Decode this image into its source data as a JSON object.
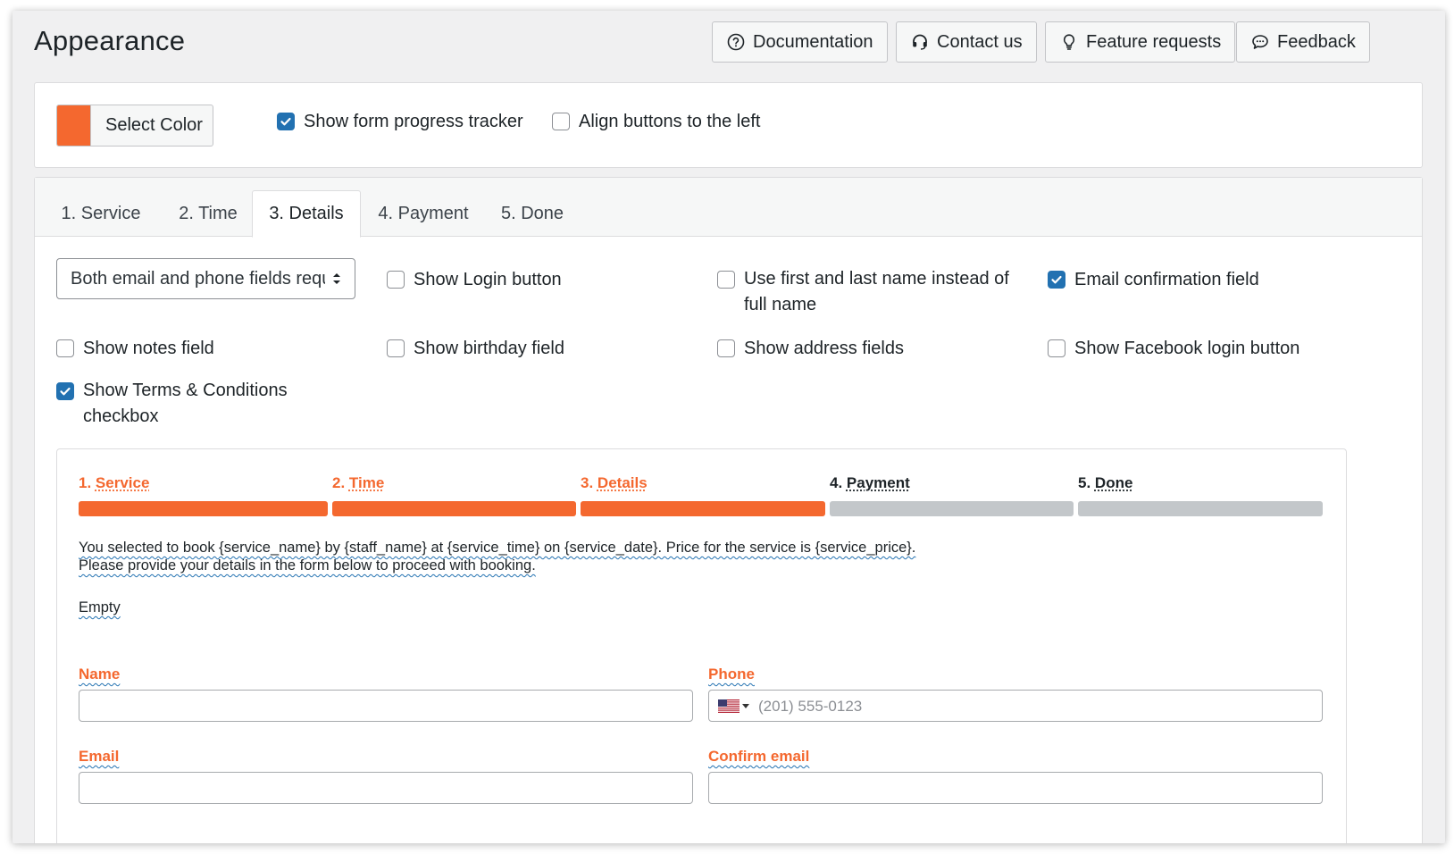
{
  "page": {
    "title": "Appearance"
  },
  "header_buttons": {
    "documentation": "Documentation",
    "contact": "Contact us",
    "features": "Feature requests",
    "feedback": "Feedback"
  },
  "general": {
    "select_color_label": "Select Color",
    "selected_color": "#f4682f",
    "show_progress_tracker": {
      "label": "Show form progress tracker",
      "checked": true
    },
    "align_buttons_left": {
      "label": "Align buttons to the left",
      "checked": false
    }
  },
  "tabs": [
    {
      "label": "1. Service",
      "active": false
    },
    {
      "label": "2. Time",
      "active": false
    },
    {
      "label": "3. Details",
      "active": true
    },
    {
      "label": "4. Payment",
      "active": false
    },
    {
      "label": "5. Done",
      "active": false
    }
  ],
  "details_options": {
    "required_fields_select": "Both email and phone fields required",
    "show_login_button": {
      "label": "Show Login button",
      "checked": false
    },
    "first_last_name": {
      "label": "Use first and last name instead of full name",
      "checked": false
    },
    "email_confirmation": {
      "label": "Email confirmation field",
      "checked": true
    },
    "show_notes": {
      "label": "Show notes field",
      "checked": false
    },
    "show_birthday": {
      "label": "Show birthday field",
      "checked": false
    },
    "show_address": {
      "label": "Show address fields",
      "checked": false
    },
    "show_facebook_login": {
      "label": "Show Facebook login button",
      "checked": false
    },
    "show_terms": {
      "label": "Show Terms & Conditions checkbox",
      "checked": true
    }
  },
  "preview": {
    "steps": [
      {
        "num": "1.",
        "name": "Service",
        "done": true
      },
      {
        "num": "2.",
        "name": "Time",
        "done": true
      },
      {
        "num": "3.",
        "name": "Details",
        "done": true
      },
      {
        "num": "4.",
        "name": "Payment",
        "done": false
      },
      {
        "num": "5.",
        "name": "Done",
        "done": false
      }
    ],
    "info_line1": "You selected to book {service_name} by {staff_name} at {service_time} on {service_date}. Price for the service is {service_price}.",
    "info_line2": "Please provide your details in the form below to proceed with booking.",
    "empty_text": "Empty",
    "name_label": "Name",
    "phone_label": "Phone",
    "phone_placeholder": "(201) 555-0123",
    "email_label": "Email",
    "confirm_email_label": "Confirm email"
  },
  "colors": {
    "accent": "#f4682f",
    "inactive_bar": "#c3c7ca",
    "checkbox_blue": "#2271b1"
  },
  "icons": {
    "documentation": "question-circle-icon",
    "contact": "headset-icon",
    "features": "lightbulb-icon",
    "feedback": "chat-bubble-icon",
    "phone_country": "us-flag-icon"
  }
}
